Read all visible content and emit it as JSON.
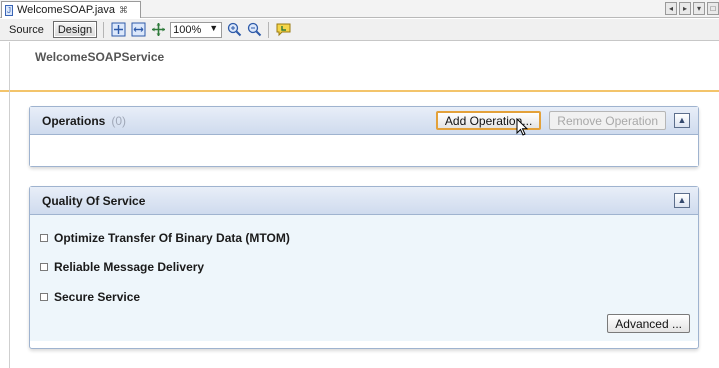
{
  "tab": {
    "title": "WelcomeSOAP.java",
    "close_glyph": "⌘"
  },
  "tab_controls": [
    "◂",
    "▸",
    "▾",
    "□"
  ],
  "toolbar": {
    "source_label": "Source",
    "design_label": "Design",
    "zoom_value": "100%",
    "zoom_caret": "▼"
  },
  "service": {
    "title": "WelcomeSOAPService"
  },
  "operations": {
    "title": "Operations",
    "count": "(0)",
    "add_label": "Add Operation...",
    "remove_label": "Remove Operation",
    "collapse_glyph": "▲"
  },
  "qos": {
    "title": "Quality Of Service",
    "collapse_glyph": "▲",
    "options": [
      {
        "label": "Optimize Transfer Of Binary Data (MTOM)",
        "checked": false
      },
      {
        "label": "Reliable Message Delivery",
        "checked": false
      },
      {
        "label": "Secure Service",
        "checked": false
      }
    ],
    "advanced_label": "Advanced ..."
  },
  "colors": {
    "header_accent": "#f3c46b",
    "panel_border": "#9fb3cf",
    "qos_background": "#eef6fb"
  }
}
